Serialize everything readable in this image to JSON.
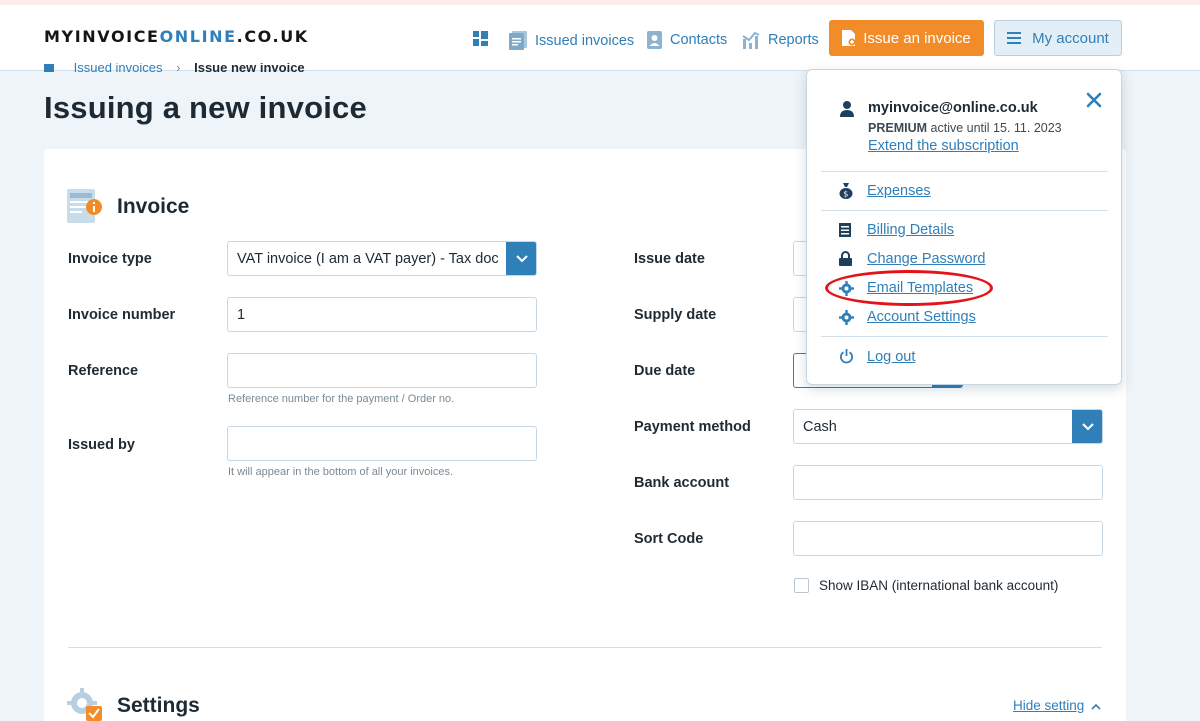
{
  "brand": {
    "logo_part1": "MYINVOICE",
    "logo_part2": "ONLINE",
    "logo_part3": ".CO.UK"
  },
  "nav": {
    "dashboard_icon": "dashboard-grid-icon",
    "issued_invoices": "Issued invoices",
    "contacts": "Contacts",
    "reports": "Reports",
    "issue_button": "Issue an invoice",
    "account_button": "My account"
  },
  "breadcrumb": {
    "item1": "Issued invoices",
    "separator": "›",
    "item2": "Issue new invoice"
  },
  "page": {
    "title": "Issuing a new invoice"
  },
  "invoice_section": {
    "title": "Invoice",
    "invoice_type_label": "Invoice type",
    "invoice_type_value": "VAT invoice (I am a VAT payer) - Tax document",
    "invoice_number_label": "Invoice number",
    "invoice_number_value": "1",
    "reference_label": "Reference",
    "reference_value": "",
    "reference_hint": "Reference number for the payment / Order no.",
    "issued_by_label": "Issued by",
    "issued_by_value": "",
    "issued_by_hint": "It will appear in the bottom of all your invoices.",
    "issue_date_label": "Issue date",
    "supply_date_label": "Supply date",
    "due_date_label": "Due date",
    "payment_method_label": "Payment method",
    "payment_method_value": "Cash",
    "bank_account_label": "Bank account",
    "sort_code_label": "Sort Code",
    "show_iban_label": "Show IBAN (international bank account)"
  },
  "settings_section": {
    "title": "Settings",
    "hide_link": "Hide setting"
  },
  "account_menu": {
    "email": "myinvoice@online.co.uk",
    "plan": "PREMIUM",
    "plan_status": "active until 15. 11. 2023",
    "extend_link": "Extend the subscription",
    "expenses": "Expenses",
    "billing_details": "Billing Details",
    "change_password": "Change Password",
    "email_templates": "Email Templates",
    "account_settings": "Account Settings",
    "log_out": "Log out"
  },
  "colors": {
    "accent": "#2f7fb9",
    "orange": "#f28c28",
    "highlight": "#e3131a"
  }
}
